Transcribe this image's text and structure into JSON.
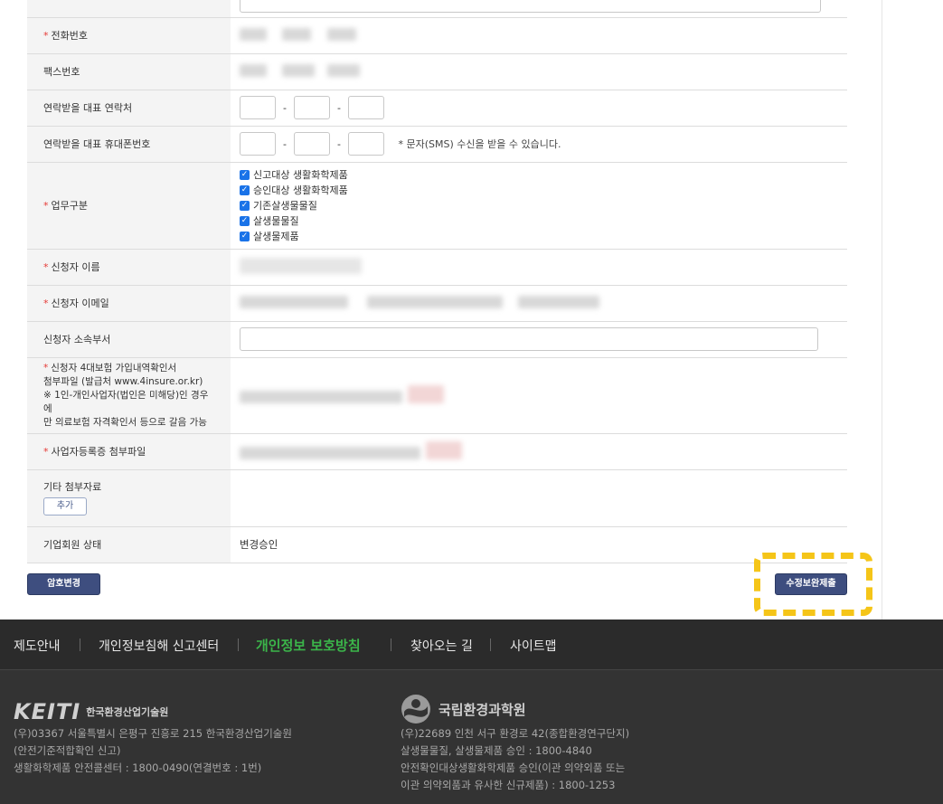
{
  "form": {
    "rows": {
      "phone_label": "전화번호",
      "fax_label": "팩스번호",
      "contact_label": "연락받을 대표 연락처",
      "mobile_label": "연락받을 대표 휴대폰번호",
      "sms_note": "* 문자(SMS) 수신을 받을 수 있습니다.",
      "dash": "-",
      "business_label": "업무구분",
      "business_options": [
        "신고대상 생활화학제품",
        "승인대상 생활화학제품",
        "기존살생물물질",
        "살생물물질",
        "살생물제품"
      ],
      "applicant_name_label": "신청자 이름",
      "applicant_email_label": "신청자 이메일",
      "applicant_dept_label": "신청자 소속부서",
      "insurance_label_1": "신청자 4대보험 가입내역확인서",
      "insurance_label_2": "첨부파일 (발급처 www.4insure.or.kr)",
      "insurance_label_3": "※ 1인-개인사업자(법인은 미해당)인 경우에",
      "insurance_label_4": "만 의료보험 자격확인서 등으로 갈음 가능",
      "bizreg_label": "사업자등록증 첨부파일",
      "other_label": "기타 첨부자료",
      "add_button": "추가",
      "status_label": "기업회원 상태",
      "status_value": "변경승인",
      "required_mark": "*"
    }
  },
  "actions": {
    "password_change": "암호변경",
    "submit_changes": "수정보완제출"
  },
  "footer": {
    "nav": [
      "제도안내",
      "개인정보침해 신고센터",
      "개인정보 보호방침",
      "찾아오는 길",
      "사이트맵"
    ],
    "keiti_logo": "KEITI",
    "keiti_name": "한국환경산업기술원",
    "keiti_addr": [
      "(우)03367 서울특별시 은평구 진흥로 215 한국환경산업기술원",
      "(안전기준적합확인 신고)",
      "생활화학제품 안전콜센터 : 1800-0490(연결번호 : 1번)"
    ],
    "nier_name": "국립환경과학원",
    "nier_addr": [
      "(우)22689 인천 서구 환경로 42(종합환경연구단지)",
      "살생물물질, 살생물제품 승인 : 1800-4840",
      "안전확인대상생활화학제품 승인(이관 의약외품 또는",
      "이관 의약외품과 유사한 신규제품) : 1800-1253"
    ]
  },
  "colors": {
    "accent_navy": "#3e4e7f",
    "highlight": "#f5c518",
    "green_link": "#3bb54a",
    "required": "#e53935"
  }
}
